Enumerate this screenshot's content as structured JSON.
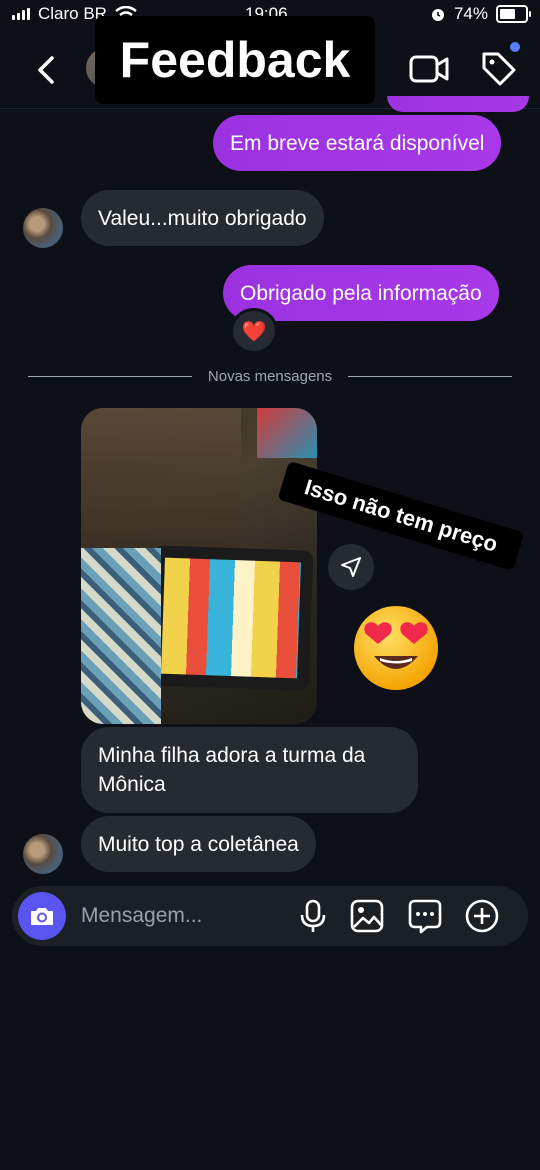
{
  "status_bar": {
    "carrier": "Claro BR",
    "time": "19:06",
    "battery": "74%",
    "battery_level": 0.74
  },
  "header": {
    "overlay_title": "Feedback"
  },
  "messages": {
    "m1": "Em breve estará disponível",
    "m2": "Valeu...muito obrigado",
    "m3": "Obrigado pela informação",
    "reaction": "❤️",
    "divider": "Novas mensagens",
    "sticker": "Isso não tem preço",
    "m4": "Minha filha adora a turma da Mônica",
    "m5": "Muito top a coletânea"
  },
  "composer": {
    "placeholder": "Mensagem..."
  },
  "colors": {
    "background": "#0d1117",
    "outgoing_bubble": "#a034e6",
    "incoming_bubble": "#262a31",
    "camera_button": "#5a54f0"
  }
}
